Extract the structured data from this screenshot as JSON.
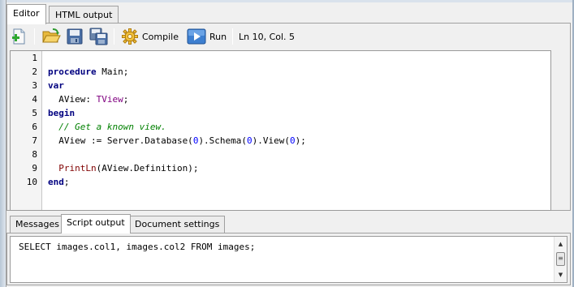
{
  "top_tabs": [
    {
      "label": "Editor",
      "active": true
    },
    {
      "label": "HTML output",
      "active": false
    }
  ],
  "toolbar": {
    "compile_label": "Compile",
    "run_label": "Run",
    "status": "Ln 10, Col. 5"
  },
  "editor": {
    "line_numbers": [
      "1",
      "2",
      "3",
      "4",
      "5",
      "6",
      "7",
      "8",
      "9",
      "10"
    ],
    "code_lines": [
      "",
      "procedure Main;",
      "var",
      "  AView: TView;",
      "begin",
      "  // Get a known view.",
      "  AView := Server.Database(0).Schema(0).View(0);",
      "",
      "  PrintLn(AView.Definition);",
      "end;"
    ]
  },
  "bottom_tabs": [
    {
      "label": "Messages",
      "active": false
    },
    {
      "label": "Script output",
      "active": true
    },
    {
      "label": "Document settings",
      "active": false
    }
  ],
  "output": {
    "text": "SELECT images.col1, images.col2 FROM images;"
  },
  "colors": {
    "keyword": "#000080",
    "type": "#800080",
    "comment": "#008000",
    "number": "#0000ff",
    "function": "#800000"
  },
  "icons": [
    "new-icon",
    "open-icon",
    "save-icon",
    "save-all-icon",
    "compile-gear-icon",
    "run-play-icon"
  ]
}
